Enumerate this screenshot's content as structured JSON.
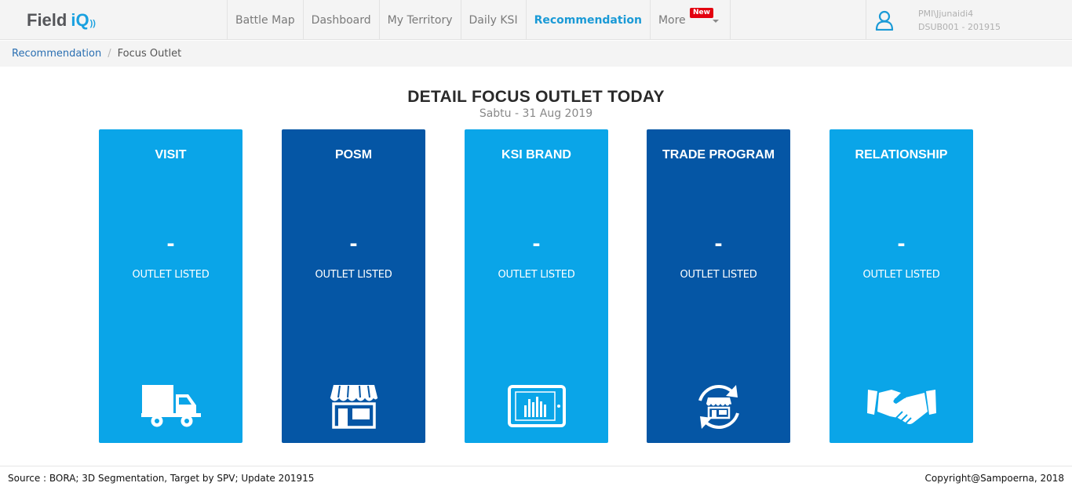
{
  "app": {
    "logo_part1": "Field",
    "logo_part2": "iQ",
    "logo_waves": "))"
  },
  "nav": {
    "items": [
      {
        "label": "Battle Map"
      },
      {
        "label": "Dashboard"
      },
      {
        "label": "My Territory"
      },
      {
        "label": "Daily KSI"
      },
      {
        "label": "Recommendation"
      }
    ],
    "more_label": "More",
    "new_badge": "New",
    "active_color": "#1a9ad6"
  },
  "user": {
    "name": "PMI\\Jjunaidi4",
    "code": "DSUB001 - 201915"
  },
  "breadcrumb": {
    "parent": "Recommendation",
    "current": "Focus Outlet"
  },
  "page": {
    "title": "DETAIL FOCUS OUTLET TODAY",
    "date": "Sabtu - 31 Aug 2019"
  },
  "cards": [
    {
      "title": "VISIT",
      "value": "-",
      "subtitle": "OUTLET LISTED",
      "icon": "truck-icon",
      "color": "#0aa5e8"
    },
    {
      "title": "POSM",
      "value": "-",
      "subtitle": "OUTLET LISTED",
      "icon": "store-icon",
      "color": "#0556a5"
    },
    {
      "title": "KSI BRAND",
      "value": "-",
      "subtitle": "OUTLET LISTED",
      "icon": "tablet-chart-icon",
      "color": "#0aa5e8"
    },
    {
      "title": "TRADE PROGRAM",
      "value": "-",
      "subtitle": "OUTLET LISTED",
      "icon": "store-refresh-icon",
      "color": "#0556a5"
    },
    {
      "title": "RELATIONSHIP",
      "value": "-",
      "subtitle": "OUTLET LISTED",
      "icon": "handshake-icon",
      "color": "#0aa5e8"
    }
  ],
  "footer": {
    "source": "Source : BORA; 3D Segmentation, Target by SPV; Update 201915",
    "copyright": "Copyright@Sampoerna, 2018"
  }
}
